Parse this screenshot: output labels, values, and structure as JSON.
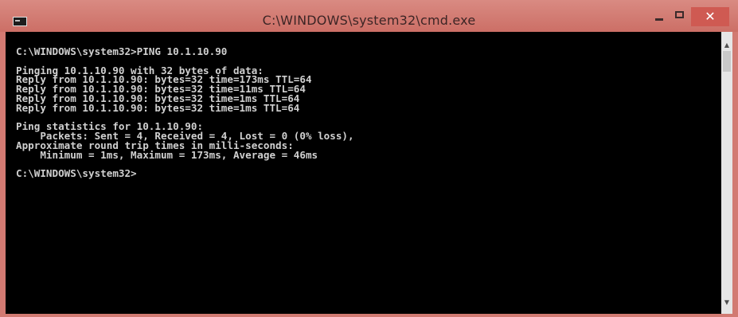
{
  "window": {
    "title": "C:\\WINDOWS\\system32\\cmd.exe",
    "close_glyph": "✕",
    "minimize_glyph": "—",
    "maximize_glyph": "☐"
  },
  "console": {
    "lines": [
      "C:\\WINDOWS\\system32>PING 10.1.10.90",
      "",
      "Pinging 10.1.10.90 with 32 bytes of data:",
      "Reply from 10.1.10.90: bytes=32 time=173ms TTL=64",
      "Reply from 10.1.10.90: bytes=32 time=11ms TTL=64",
      "Reply from 10.1.10.90: bytes=32 time=1ms TTL=64",
      "Reply from 10.1.10.90: bytes=32 time=1ms TTL=64",
      "",
      "Ping statistics for 10.1.10.90:",
      "    Packets: Sent = 4, Received = 4, Lost = 0 (0% loss),",
      "Approximate round trip times in milli-seconds:",
      "    Minimum = 1ms, Maximum = 173ms, Average = 46ms",
      "",
      "C:\\WINDOWS\\system32>"
    ]
  },
  "scrollbar": {
    "up_glyph": "▲",
    "down_glyph": "▼"
  },
  "colors": {
    "titlebar": "#cc6f66",
    "console_bg": "#000000",
    "console_text": "#d0d0d0",
    "close_button": "#cf5a52"
  }
}
